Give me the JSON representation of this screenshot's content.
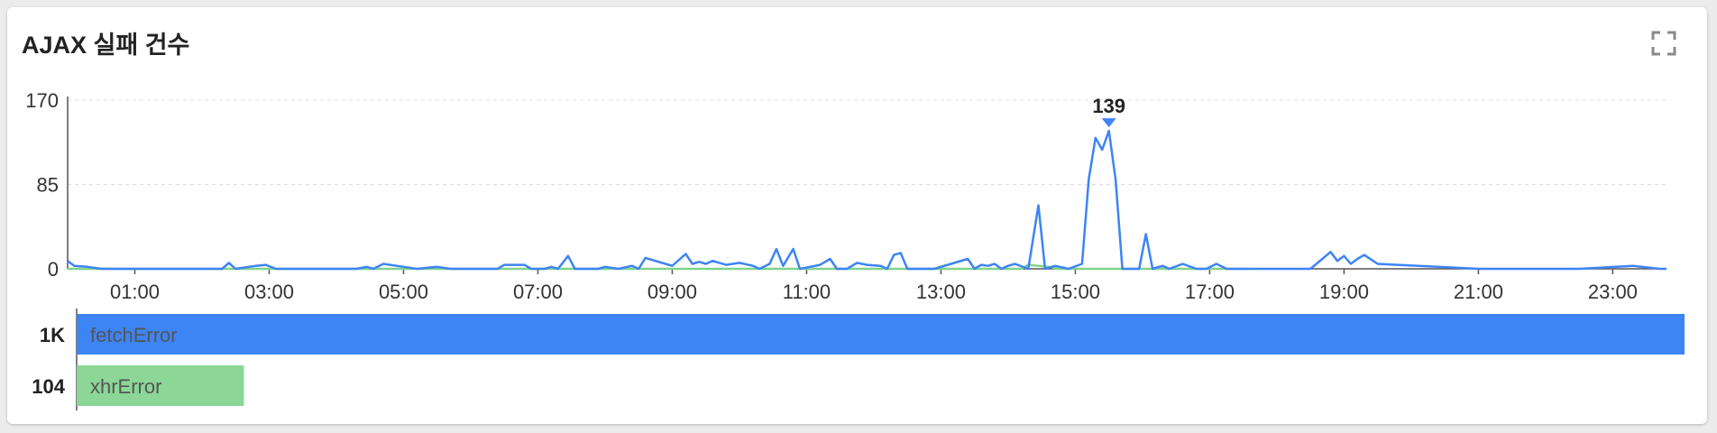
{
  "panel": {
    "title": "AJAX 실패 건수",
    "expand_icon": "fullscreen-expand-icon"
  },
  "chart_data": [
    {
      "type": "line",
      "title": "",
      "xlabel": "",
      "ylabel": "",
      "x_ticks": [
        "01:00",
        "03:00",
        "05:00",
        "07:00",
        "09:00",
        "11:00",
        "13:00",
        "15:00",
        "17:00",
        "19:00",
        "21:00",
        "23:00"
      ],
      "xlim_hours": [
        0,
        23.8
      ],
      "y_ticks": [
        0,
        85,
        170
      ],
      "ylim": [
        0,
        170
      ],
      "grid": true,
      "peak_annotation": {
        "x_hours": 14.5,
        "value": 139,
        "label": "139"
      },
      "series": [
        {
          "name": "fetchError",
          "color": "#3d84f5",
          "points": [
            [
              0.0,
              8
            ],
            [
              0.1,
              3
            ],
            [
              0.3,
              2
            ],
            [
              0.5,
              0
            ],
            [
              1.0,
              0
            ],
            [
              2.0,
              0
            ],
            [
              2.3,
              0
            ],
            [
              2.4,
              6
            ],
            [
              2.5,
              0
            ],
            [
              2.8,
              3
            ],
            [
              2.95,
              4
            ],
            [
              3.1,
              0
            ],
            [
              4.3,
              0
            ],
            [
              4.45,
              2
            ],
            [
              4.55,
              0
            ],
            [
              4.7,
              5
            ],
            [
              5.0,
              2
            ],
            [
              5.2,
              0
            ],
            [
              5.5,
              2
            ],
            [
              5.7,
              0
            ],
            [
              6.4,
              0
            ],
            [
              6.5,
              4
            ],
            [
              6.8,
              4
            ],
            [
              6.9,
              0
            ],
            [
              7.1,
              0
            ],
            [
              7.2,
              2
            ],
            [
              7.3,
              0
            ],
            [
              7.45,
              13
            ],
            [
              7.55,
              0
            ],
            [
              7.9,
              0
            ],
            [
              8.0,
              2
            ],
            [
              8.2,
              0
            ],
            [
              8.4,
              3
            ],
            [
              8.5,
              0
            ],
            [
              8.6,
              11
            ],
            [
              8.9,
              5
            ],
            [
              9.0,
              3
            ],
            [
              9.2,
              15
            ],
            [
              9.3,
              5
            ],
            [
              9.4,
              7
            ],
            [
              9.5,
              5
            ],
            [
              9.6,
              8
            ],
            [
              9.8,
              4
            ],
            [
              10.0,
              6
            ],
            [
              10.2,
              3
            ],
            [
              10.3,
              0
            ],
            [
              10.45,
              5
            ],
            [
              10.55,
              20
            ],
            [
              10.65,
              3
            ],
            [
              10.8,
              20
            ],
            [
              10.9,
              0
            ],
            [
              11.2,
              4
            ],
            [
              11.35,
              10
            ],
            [
              11.45,
              0
            ],
            [
              11.6,
              0
            ],
            [
              11.75,
              6
            ],
            [
              11.9,
              4
            ],
            [
              12.1,
              3
            ],
            [
              12.2,
              0
            ],
            [
              12.3,
              14
            ],
            [
              12.4,
              16
            ],
            [
              12.5,
              0
            ],
            [
              12.9,
              0
            ],
            [
              13.4,
              10
            ],
            [
              13.5,
              0
            ],
            [
              13.6,
              4
            ],
            [
              13.7,
              3
            ],
            [
              13.8,
              5
            ],
            [
              13.9,
              0
            ],
            [
              14.0,
              3
            ],
            [
              14.1,
              5
            ],
            [
              14.3,
              0
            ],
            [
              14.45,
              64
            ],
            [
              14.55,
              0
            ],
            [
              14.7,
              3
            ],
            [
              14.9,
              0
            ],
            [
              15.1,
              5
            ],
            [
              15.2,
              90
            ],
            [
              15.3,
              132
            ],
            [
              15.4,
              120
            ],
            [
              15.5,
              139
            ],
            [
              15.6,
              90
            ],
            [
              15.7,
              0
            ],
            [
              15.95,
              0
            ],
            [
              16.05,
              35
            ],
            [
              16.15,
              0
            ],
            [
              16.3,
              3
            ],
            [
              16.4,
              0
            ],
            [
              16.6,
              5
            ],
            [
              16.8,
              0
            ],
            [
              16.95,
              0
            ],
            [
              17.1,
              5
            ],
            [
              17.25,
              0
            ],
            [
              17.5,
              0
            ],
            [
              17.6,
              0
            ],
            [
              18.5,
              0
            ],
            [
              18.8,
              17
            ],
            [
              18.9,
              8
            ],
            [
              19.0,
              13
            ],
            [
              19.1,
              5
            ],
            [
              19.2,
              10
            ],
            [
              19.3,
              14
            ],
            [
              19.5,
              5
            ],
            [
              21.0,
              0
            ],
            [
              22.5,
              0
            ],
            [
              23.3,
              3
            ],
            [
              23.7,
              0
            ],
            [
              23.8,
              0
            ]
          ]
        },
        {
          "name": "xhrError",
          "color": "#7fd38b",
          "points": [
            [
              0.0,
              0
            ],
            [
              12.0,
              0
            ],
            [
              13.8,
              0
            ],
            [
              14.2,
              0
            ],
            [
              14.3,
              4
            ],
            [
              14.45,
              3
            ],
            [
              14.6,
              2
            ],
            [
              14.75,
              0
            ],
            [
              15.0,
              0
            ],
            [
              17.6,
              0
            ]
          ]
        }
      ]
    },
    {
      "type": "bar",
      "orientation": "horizontal",
      "title": "",
      "categories": [
        "fetchError",
        "xhrError"
      ],
      "value_labels": [
        "1K",
        "104"
      ],
      "values": [
        1000,
        104
      ],
      "colors": [
        "#3d84f5",
        "#8cd697"
      ]
    }
  ]
}
